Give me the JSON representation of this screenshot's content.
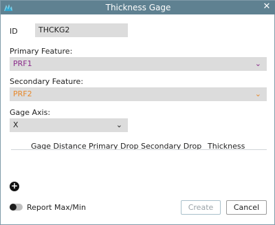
{
  "window": {
    "title": "Thickness Gage"
  },
  "id_field": {
    "label": "ID",
    "value": "THCKG2"
  },
  "primary_feature": {
    "label": "Primary Feature:",
    "value": "PRF1",
    "color": "#8a2b8a"
  },
  "secondary_feature": {
    "label": "Secondary Feature:",
    "value": "PRF2",
    "color": "#e8892b"
  },
  "gage_axis": {
    "label": "Gage Axis:",
    "value": "X"
  },
  "table": {
    "columns": [
      "Gage Distance",
      "Primary Drop",
      "Secondary Drop",
      "Thickness"
    ],
    "rows": []
  },
  "report_toggle": {
    "label": "Report Max/Min",
    "on": false
  },
  "buttons": {
    "create": "Create",
    "cancel": "Cancel"
  },
  "icons": {
    "app": "app-logo-icon",
    "close": "close-icon",
    "chevron": "chevron-down-icon",
    "add": "add-circle-icon"
  }
}
